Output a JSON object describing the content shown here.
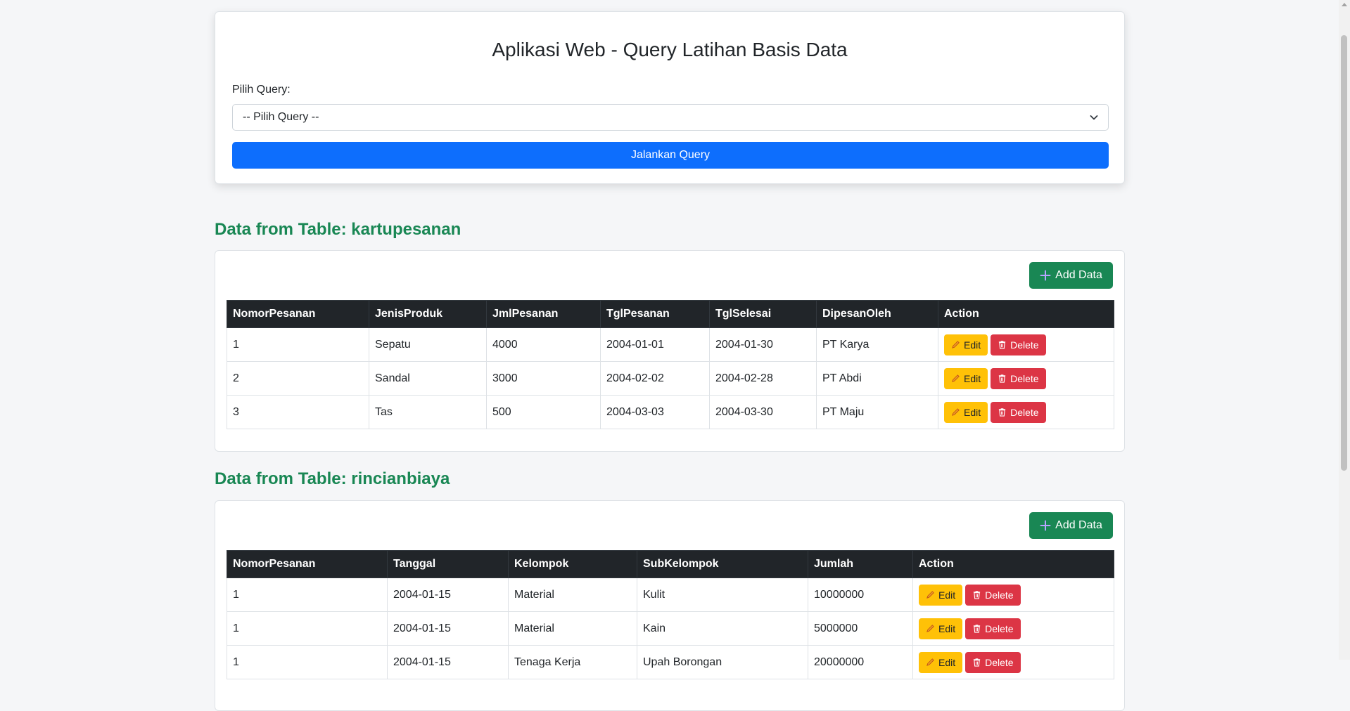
{
  "query": {
    "title": "Aplikasi Web - Query Latihan Basis Data",
    "select_label": "Pilih Query:",
    "select_value": "-- Pilih Query --",
    "run_button": "Jalankan Query"
  },
  "sections": [
    {
      "title": "Data from Table: kartupesanan",
      "add_label": "Add Data",
      "columns": [
        "NomorPesanan",
        "JenisProduk",
        "JmlPesanan",
        "TglPesanan",
        "TglSelesai",
        "DipesanOleh",
        "Action"
      ],
      "rows": [
        [
          "1",
          "Sepatu",
          "4000",
          "2004-01-01",
          "2004-01-30",
          "PT Karya"
        ],
        [
          "2",
          "Sandal",
          "3000",
          "2004-02-02",
          "2004-02-28",
          "PT Abdi"
        ],
        [
          "3",
          "Tas",
          "500",
          "2004-03-03",
          "2004-03-30",
          "PT Maju"
        ]
      ]
    },
    {
      "title": "Data from Table: rincianbiaya",
      "add_label": "Add Data",
      "columns": [
        "NomorPesanan",
        "Tanggal",
        "Kelompok",
        "SubKelompok",
        "Jumlah",
        "Action"
      ],
      "rows": [
        [
          "1",
          "2004-01-15",
          "Material",
          "Kulit",
          "10000000"
        ],
        [
          "1",
          "2004-01-15",
          "Material",
          "Kain",
          "5000000"
        ],
        [
          "1",
          "2004-01-15",
          "Tenaga Kerja",
          "Upah Borongan",
          "20000000"
        ]
      ]
    }
  ],
  "actions": {
    "edit": "Edit",
    "delete": "Delete"
  },
  "colors": {
    "primary": "#0d6efd",
    "success": "#198754",
    "warning": "#ffc107",
    "danger": "#dc3545",
    "dark": "#212529"
  }
}
